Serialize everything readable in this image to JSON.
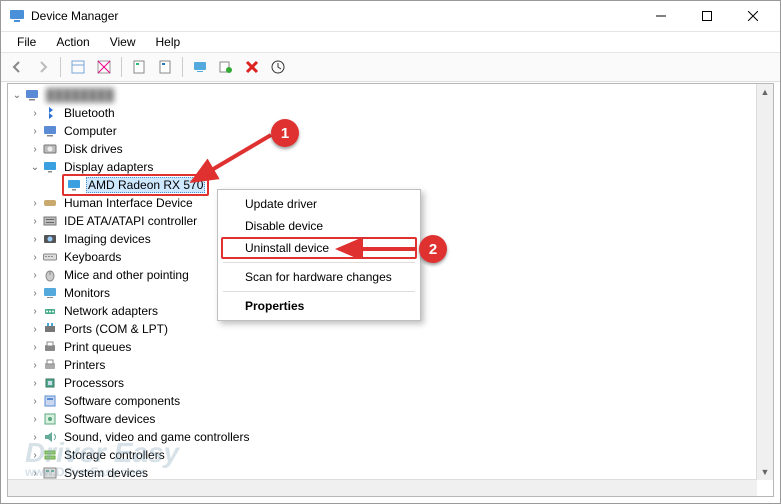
{
  "window": {
    "title": "Device Manager"
  },
  "menu": {
    "file": "File",
    "action": "Action",
    "view": "View",
    "help": "Help"
  },
  "toolbar": {
    "back": "back-icon",
    "forward": "forward-icon",
    "show_all": "show-all-icon",
    "help": "help-icon",
    "info1": "info-icon",
    "info2": "info-icon",
    "monitor": "monitor-icon",
    "scan": "scan-hardware-icon",
    "delete": "delete-icon",
    "update": "update-driver-icon"
  },
  "tree": {
    "root": "████████",
    "items": [
      {
        "label": "Bluetooth",
        "icon": "bluetooth",
        "expandable": true
      },
      {
        "label": "Computer",
        "icon": "computer",
        "expandable": true
      },
      {
        "label": "Disk drives",
        "icon": "disk",
        "expandable": true
      },
      {
        "label": "Display adapters",
        "icon": "display",
        "expandable": true,
        "expanded": true,
        "children": [
          {
            "label": "AMD Radeon RX 570",
            "icon": "display",
            "selected": true,
            "highlighted": true
          }
        ]
      },
      {
        "label": "Human Interface Device",
        "icon": "hid",
        "expandable": true,
        "truncated": true
      },
      {
        "label": "IDE ATA/ATAPI controller",
        "icon": "ide",
        "expandable": true,
        "truncated": true
      },
      {
        "label": "Imaging devices",
        "icon": "imaging",
        "expandable": true
      },
      {
        "label": "Keyboards",
        "icon": "keyboard",
        "expandable": true
      },
      {
        "label": "Mice and other pointing",
        "icon": "mouse",
        "expandable": true,
        "truncated": true
      },
      {
        "label": "Monitors",
        "icon": "monitor",
        "expandable": true
      },
      {
        "label": "Network adapters",
        "icon": "network",
        "expandable": true
      },
      {
        "label": "Ports (COM & LPT)",
        "icon": "ports",
        "expandable": true
      },
      {
        "label": "Print queues",
        "icon": "printq",
        "expandable": true
      },
      {
        "label": "Printers",
        "icon": "printer",
        "expandable": true
      },
      {
        "label": "Processors",
        "icon": "cpu",
        "expandable": true
      },
      {
        "label": "Software components",
        "icon": "swcomp",
        "expandable": true
      },
      {
        "label": "Software devices",
        "icon": "swdev",
        "expandable": true
      },
      {
        "label": "Sound, video and game controllers",
        "icon": "sound",
        "expandable": true
      },
      {
        "label": "Storage controllers",
        "icon": "storage",
        "expandable": true
      },
      {
        "label": "System devices",
        "icon": "system",
        "expandable": true
      }
    ]
  },
  "context_menu": {
    "update": "Update driver",
    "disable": "Disable device",
    "uninstall": "Uninstall device",
    "scan": "Scan for hardware changes",
    "properties": "Properties"
  },
  "callouts": {
    "one": "1",
    "two": "2"
  },
  "watermark": {
    "brand": "Driver Easy",
    "url": "www.DriverEasy.com"
  }
}
